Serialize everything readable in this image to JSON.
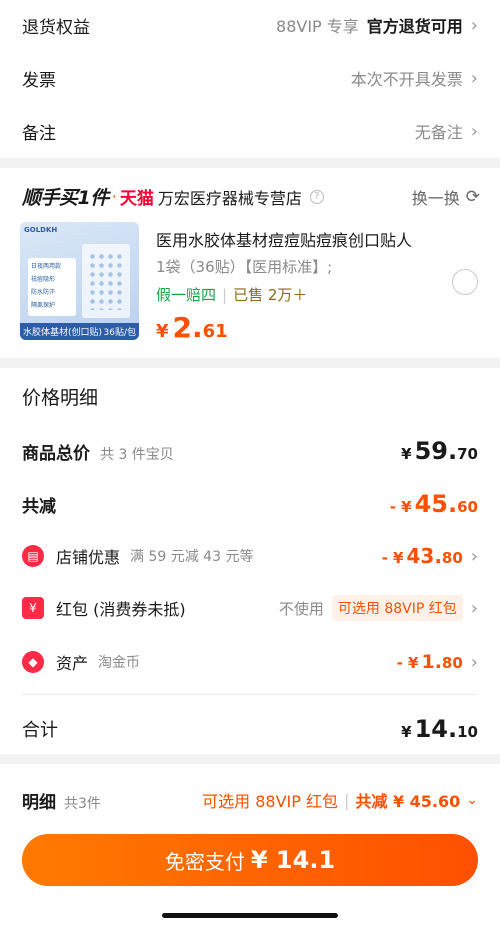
{
  "top_rows": [
    {
      "label": "退货权益",
      "value_gray": "88VIP 专享",
      "value_strong": "官方退货可用"
    },
    {
      "label": "发票",
      "value_gray": "本次不开具发票"
    },
    {
      "label": "备注",
      "value_gray": "无备注"
    }
  ],
  "store": {
    "logo": "顺手买1件",
    "dot": "·",
    "platform": "天猫",
    "name": "万宏医疗器械专营店",
    "swap_label": "换一换"
  },
  "product": {
    "thumb_brand": "GOLDKH",
    "thumb_features": [
      "日夜两用款",
      "祛痘隐形",
      "防水防汗",
      "隔离保护"
    ],
    "thumb_band_left": "水胶体基材(创口贴)",
    "thumb_band_right": "36贴/包",
    "title": "医用水胶体基材痘痘贴痘痕创口贴人",
    "spec": "1袋（36贴）【医用标准】;",
    "tag_guarantee": "假一赔四",
    "tag_sold": "已售 2万＋",
    "price_currency": "¥",
    "price_int": "2.",
    "price_dec": "61"
  },
  "price_detail": {
    "title": "价格明细",
    "goods_total": {
      "label": "商品总价",
      "sub": "共 3 件宝贝",
      "currency": "¥",
      "int": "59.",
      "dec": "70"
    },
    "total_reduce": {
      "label": "共减",
      "currency": "- ¥",
      "int": "45.",
      "dec": "60"
    },
    "store_promo": {
      "label": "店铺优惠",
      "sub": "满 59 元减 43 元等",
      "currency": "- ¥",
      "int": "43.",
      "dec": "80"
    },
    "redpacket": {
      "label": "红包 (消费券未抵)",
      "not_use": "不使用",
      "pill": "可选用 88VIP 红包"
    },
    "assets": {
      "label": "资产",
      "sub": "淘金币",
      "currency": "- ¥",
      "int": "1.",
      "dec": "80"
    },
    "sum": {
      "label": "合计",
      "currency": "¥",
      "int": "14.",
      "dec": "10"
    }
  },
  "bottom": {
    "detail_label": "明细",
    "detail_count": "共3件",
    "redpacket_hint": "可选用 88VIP 红包",
    "reduce_hint": "共减 ¥ 45.60",
    "pay_label": "免密支付",
    "pay_amount": "¥ 14.1"
  },
  "colors": {
    "accent": "#ff5000",
    "green": "#18a54a",
    "tmall": "#ff0036"
  }
}
